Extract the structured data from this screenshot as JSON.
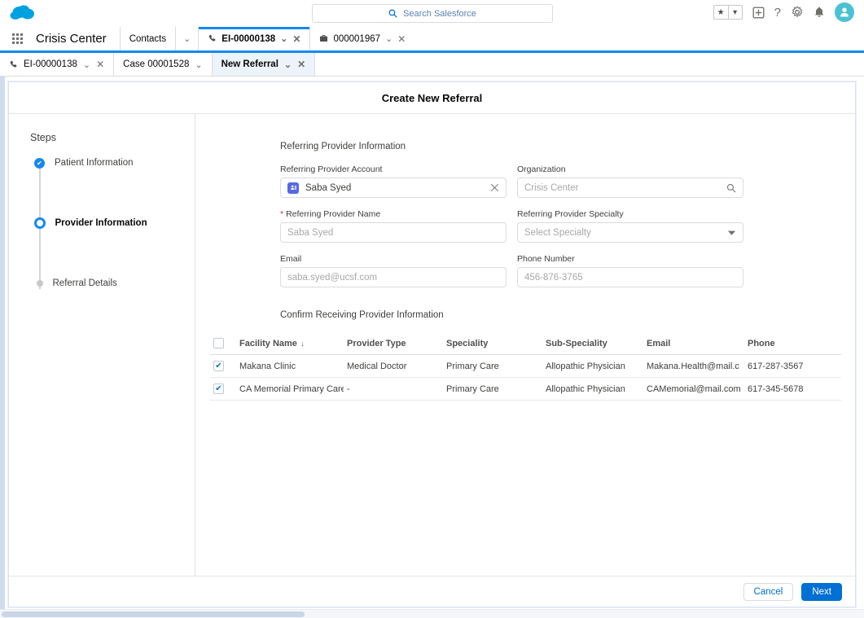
{
  "colors": {
    "brand_blue": "#1589ee",
    "link_blue": "#0070d2",
    "avatar_teal": "#4bc2d4",
    "account_icon_purple": "#5867e8",
    "required_red": "#c23934",
    "active_tab_bg": "#ecf3fb"
  },
  "global_header": {
    "logo_name": "salesforce-cloud-logo",
    "search": {
      "placeholder": "Search Salesforce",
      "value": "",
      "icon": "search-icon"
    },
    "icons": [
      {
        "name": "favorites-star-icon",
        "glyph": "★"
      },
      {
        "name": "favorites-caret-icon",
        "glyph": "▾"
      },
      {
        "name": "add-icon",
        "glyph": "+"
      },
      {
        "name": "help-icon",
        "glyph": "?"
      },
      {
        "name": "setup-gear-icon",
        "glyph": "⚙"
      },
      {
        "name": "notifications-bell-icon",
        "glyph": "🔔"
      },
      {
        "name": "user-avatar",
        "glyph": "person"
      }
    ]
  },
  "primary_tabs": {
    "app_launcher_label": "app-launcher",
    "app_name": "Crisis Center",
    "tabs": [
      {
        "label": "Contacts",
        "icon": null,
        "active": false,
        "closable": false,
        "has_caret": true
      },
      {
        "label": "EI-00000138",
        "icon": "phone-icon",
        "active": true,
        "closable": true,
        "has_caret": true
      },
      {
        "label": "000001967",
        "icon": "case-briefcase-icon",
        "active": false,
        "closable": true,
        "has_caret": true
      }
    ]
  },
  "secondary_tabs": [
    {
      "label": "EI-00000138",
      "icon": "phone-icon",
      "active": false,
      "closable": true,
      "has_caret": true
    },
    {
      "label": "Case 00001528",
      "icon": null,
      "active": false,
      "closable": false,
      "has_caret": true
    },
    {
      "label": "New Referral",
      "icon": null,
      "active": true,
      "closable": true,
      "has_caret": true
    }
  ],
  "panel": {
    "title": "Create New Referral"
  },
  "steps": {
    "heading": "Steps",
    "items": [
      {
        "label": "Patient Information",
        "state": "done"
      },
      {
        "label": "Provider Information",
        "state": "current"
      },
      {
        "label": "Referral Details",
        "state": "pending"
      }
    ]
  },
  "form": {
    "section_title": "Referring Provider Information",
    "fields": {
      "referring_provider_account": {
        "label": "Referring Provider Account",
        "value": "Saba Syed",
        "required": false,
        "icon": "contact-record-icon",
        "trailing_icon": "clear-x-icon"
      },
      "organization": {
        "label": "Organization",
        "value": "Crisis Center",
        "is_placeholder": true,
        "required": false,
        "trailing_icon": "search-icon"
      },
      "referring_provider_name": {
        "label": "Referring Provider Name",
        "value": "Saba Syed",
        "is_placeholder": true,
        "required": true
      },
      "referring_provider_specialty": {
        "label": "Referring Provider Specialty",
        "value": "Select Specialty",
        "is_placeholder": true,
        "required": false,
        "trailing_icon": "chevron-down-icon"
      },
      "email": {
        "label": "Email",
        "value": "saba.syed@ucsf.com",
        "is_placeholder": true,
        "required": false
      },
      "phone_number": {
        "label": "Phone Number",
        "value": "456-876-3765",
        "is_placeholder": true,
        "required": false
      }
    }
  },
  "table": {
    "title": "Confirm Receiving Provider Information",
    "select_all_checked": false,
    "sort_column": "Facility Name",
    "sort_direction": "desc",
    "columns": [
      "Facility Name",
      "Provider Type",
      "Speciality",
      "Sub-Speciality",
      "Email",
      "Phone"
    ],
    "rows": [
      {
        "checked": true,
        "facility_name": "Makana Clinic",
        "provider_type": "Medical Doctor",
        "speciality": "Primary Care",
        "sub_speciality": "Allopathic Physician",
        "email": "Makana.Health@mail.c",
        "phone": "617-287-3567"
      },
      {
        "checked": true,
        "facility_name": "CA Memorial Primary Care",
        "provider_type": "-",
        "speciality": "Primary Care",
        "sub_speciality": "Allopathic Physician",
        "email": "CAMemorial@mail.com",
        "phone": "617-345-5678"
      }
    ]
  },
  "footer": {
    "cancel_label": "Cancel",
    "next_label": "Next"
  }
}
